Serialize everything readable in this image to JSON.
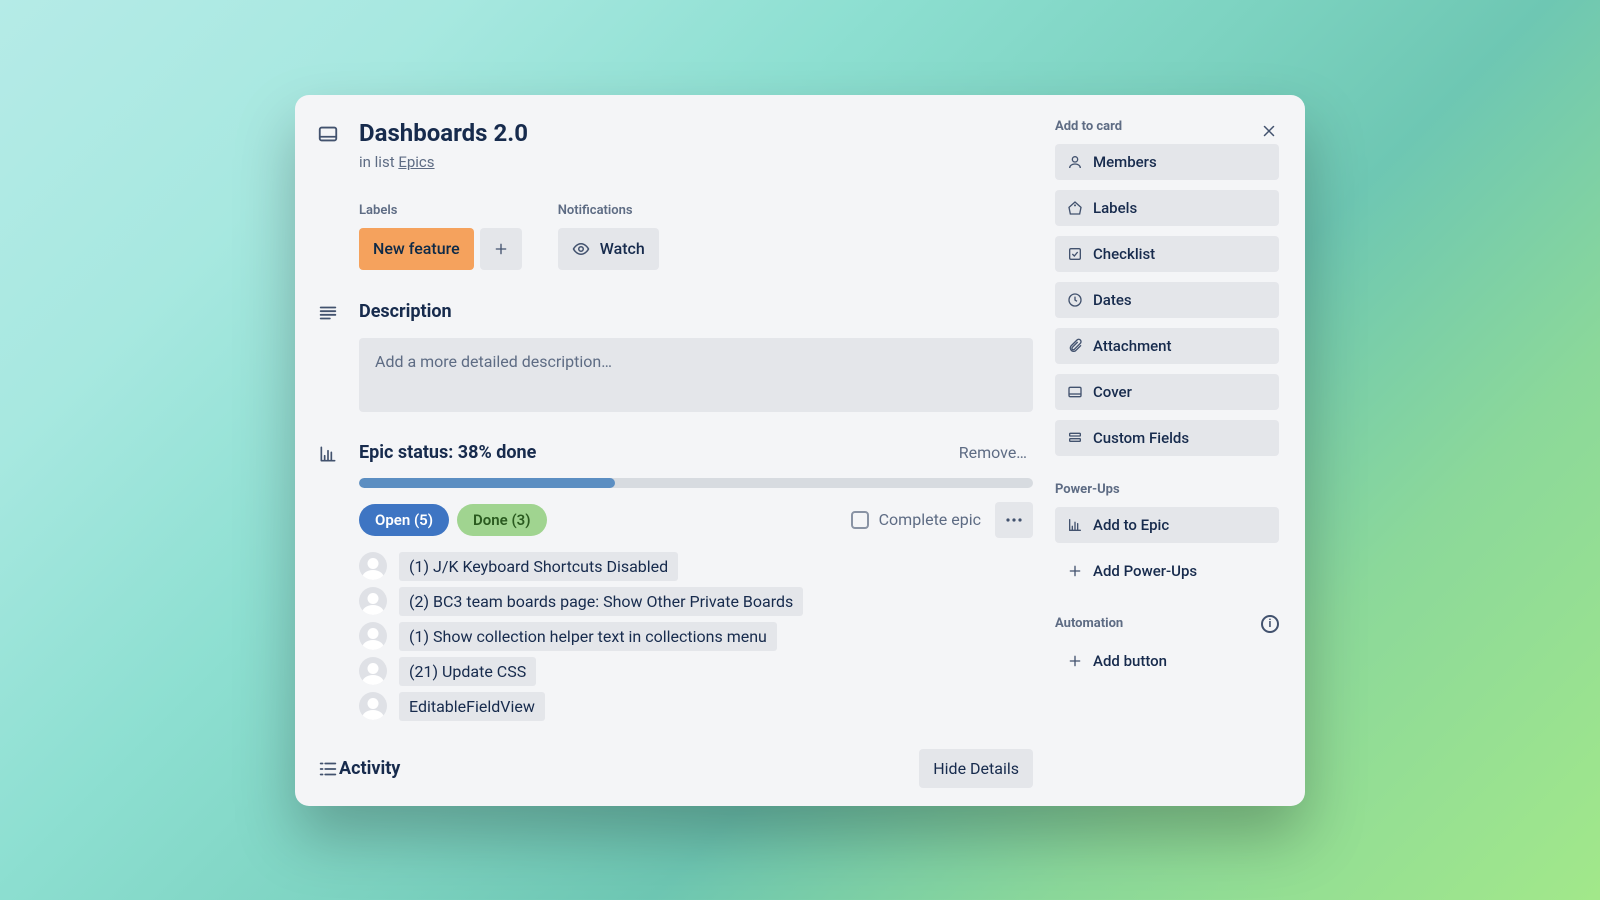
{
  "header": {
    "title": "Dashboards 2.0",
    "inListPrefix": "in list ",
    "listName": "Epics"
  },
  "labels": {
    "heading": "Labels",
    "items": [
      "New feature"
    ]
  },
  "notifications": {
    "heading": "Notifications",
    "watch": "Watch"
  },
  "description": {
    "heading": "Description",
    "placeholder": "Add a more detailed description…"
  },
  "epic": {
    "heading": "Epic status: 38% done",
    "progressPercent": 38,
    "remove": "Remove…",
    "openPill": "Open (5)",
    "donePill": "Done (3)",
    "completeEpic": "Complete epic",
    "tasks": [
      "(1) J/K Keyboard Shortcuts Disabled",
      "(2) BC3 team boards page: Show Other Private Boards",
      "(1) Show collection helper text in collections menu",
      "(21) Update CSS",
      "EditableFieldView"
    ]
  },
  "activity": {
    "heading": "Activity",
    "hideDetails": "Hide Details"
  },
  "sidebar": {
    "addToCard": {
      "label": "Add to card",
      "items": [
        "Members",
        "Labels",
        "Checklist",
        "Dates",
        "Attachment",
        "Cover",
        "Custom Fields"
      ]
    },
    "powerUps": {
      "label": "Power-Ups",
      "addToEpic": "Add to Epic",
      "addPowerUps": "Add Power-Ups"
    },
    "automation": {
      "label": "Automation",
      "addButton": "Add button"
    }
  }
}
